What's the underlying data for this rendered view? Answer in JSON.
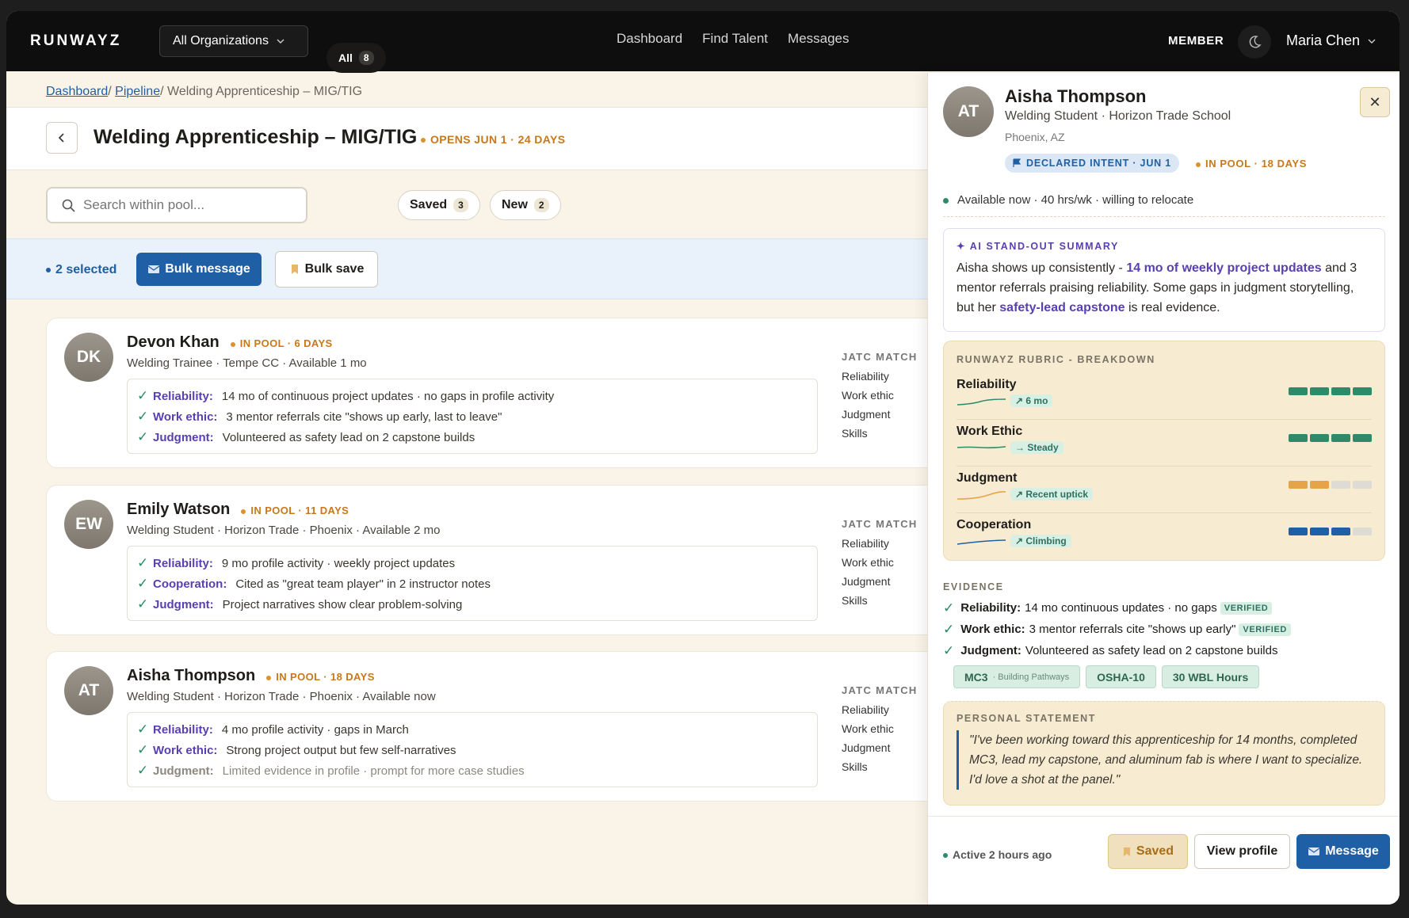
{
  "topbar": {
    "logo": "RUNWAYZ",
    "org_selector": "All Organizations",
    "nav": [
      "Dashboard",
      "Find Talent",
      "Messages"
    ],
    "role": "MEMBER",
    "user_name": "Maria Chen"
  },
  "breadcrumb": {
    "items": [
      "Dashboard",
      "Pipeline"
    ],
    "current": "Welding Apprenticeship – MIG/TIG"
  },
  "page": {
    "title": "Welding Apprenticeship – MIG/TIG",
    "opens": "OPENS JUN 1 · 24 DAYS"
  },
  "search": {
    "placeholder": "Search within pool..."
  },
  "filters": [
    {
      "label": "All",
      "count": "8",
      "active": true
    },
    {
      "label": "Saved",
      "count": "3",
      "active": false
    },
    {
      "label": "New",
      "count": "2",
      "active": false
    }
  ],
  "selection": {
    "count_label": "2 selected",
    "bulk_message": "Bulk message",
    "bulk_save": "Bulk save"
  },
  "candidates": [
    {
      "initials": "DK",
      "name": "Devon Khan",
      "pool": "IN POOL · 6 DAYS",
      "sub": "Welding Trainee · Tempe CC · Available 1 mo",
      "evidence": [
        {
          "label": "Reliability:",
          "text": "14 mo of continuous project updates · no gaps in profile activity"
        },
        {
          "label": "Work ethic:",
          "text": "3 mentor referrals cite \"shows up early, last to leave\""
        },
        {
          "label": "Judgment:",
          "text": "Volunteered as safety lead on 2 capstone builds"
        }
      ]
    },
    {
      "initials": "EW",
      "name": "Emily Watson",
      "pool": "IN POOL · 11 DAYS",
      "sub": "Welding Student · Horizon Trade · Phoenix · Available 2 mo",
      "evidence": [
        {
          "label": "Reliability:",
          "text": "9 mo profile activity · weekly project updates"
        },
        {
          "label": "Cooperation:",
          "text": "Cited as \"great team player\" in 2 instructor notes"
        },
        {
          "label": "Judgment:",
          "text": "Project narratives show clear problem-solving"
        }
      ]
    },
    {
      "initials": "AT",
      "name": "Aisha Thompson",
      "pool": "IN POOL · 18 DAYS",
      "sub": "Welding Student · Horizon Trade · Phoenix · Available now",
      "evidence": [
        {
          "label": "Reliability:",
          "text": "4 mo profile activity · gaps in March"
        },
        {
          "label": "Work ethic:",
          "text": "Strong project output but few self-narratives"
        },
        {
          "label": "Judgment:",
          "text": "Limited evidence in profile · prompt for more case studies"
        }
      ]
    }
  ],
  "jatc": {
    "header": "JATC MATCH",
    "items": [
      "Reliability",
      "Work ethic",
      "Judgment",
      "Skills"
    ]
  },
  "panel": {
    "initials": "AT",
    "name": "Aisha Thompson",
    "sub": "Welding Student · Horizon Trade School",
    "location": "Phoenix, AZ",
    "intent": "DECLARED INTENT · JUN 1",
    "pool": "IN POOL · 18 DAYS",
    "availability": "Available now · 40 hrs/wk · willing to relocate",
    "ai_header": "AI STAND-OUT SUMMARY",
    "ai_text_1": "Aisha shows up consistently - ",
    "ai_hl_1": "14 mo of weekly project updates",
    "ai_text_2": " and 3 mentor referrals praising reliability. Some gaps in judgment storytelling, but her ",
    "ai_hl_2": "safety-lead capstone",
    "ai_text_3": " is real evidence.",
    "rubric_header": "RUNWAYZ RUBRIC - BREAKDOWN",
    "rubric": [
      {
        "name": "Reliability",
        "trend": "↗ 6 mo",
        "filled": 4,
        "color": "#2f8a6a",
        "spark": "#2f8a6a"
      },
      {
        "name": "Work Ethic",
        "trend": "→ Steady",
        "filled": 4,
        "color": "#2f8a6a",
        "spark": "#2f8a6a"
      },
      {
        "name": "Judgment",
        "trend": "↗ Recent uptick",
        "filled": 2,
        "color": "#e5a44a",
        "spark": "#e5a44a"
      },
      {
        "name": "Cooperation",
        "trend": "↗ Climbing",
        "filled": 3,
        "color": "#1f5fa6",
        "spark": "#1f5fa6"
      }
    ],
    "evidence_header": "EVIDENCE",
    "evidence": [
      {
        "label": "Reliability:",
        "text": "14 mo continuous updates · no gaps",
        "badge": "VERIFIED"
      },
      {
        "label": "Work ethic:",
        "text": "3 mentor referrals cite \"shows up early\"",
        "badge": "VERIFIED"
      },
      {
        "label": "Judgment:",
        "text": "Volunteered as safety lead on 2 capstone builds",
        "badge": ""
      }
    ],
    "credentials": [
      {
        "name": "MC3",
        "note": "· Building Pathways"
      },
      {
        "name": "OSHA-10",
        "note": ""
      },
      {
        "name": "30 WBL Hours",
        "note": ""
      }
    ],
    "statement_header": "PERSONAL STATEMENT",
    "statement": "\"I've been working toward this apprenticeship for 14 months, completed MC3, lead my capstone, and aluminum fab is where I want to specialize. I'd love a shot at the panel.\"",
    "active": "Active 2 hours ago",
    "btn_saved": "Saved",
    "btn_view": "View profile",
    "btn_message": "Message"
  }
}
